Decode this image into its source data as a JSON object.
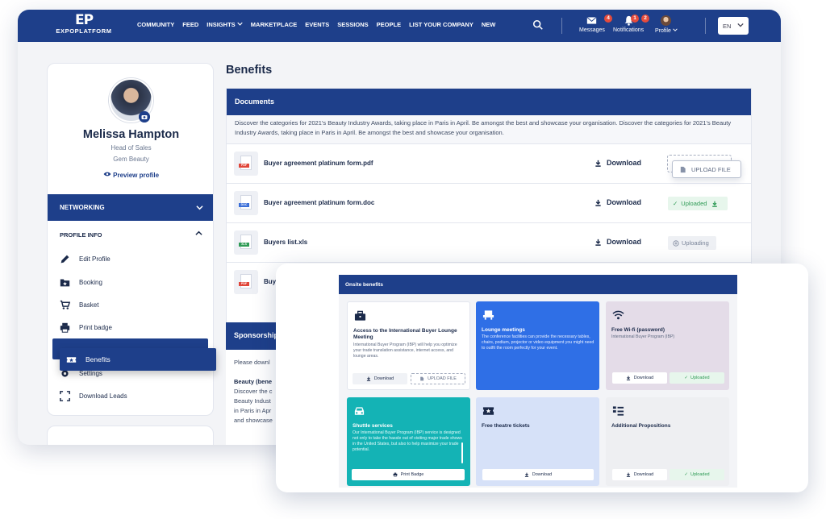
{
  "brand": {
    "mark": "EP",
    "word": "EXPOPLATFORM"
  },
  "nav": [
    "COMMUNITY",
    "FEED",
    "INSIGHTS",
    "MARKETPLACE",
    "EVENTS",
    "SESSIONS",
    "PEOPLE",
    "LIST YOUR COMPANY",
    "NEW"
  ],
  "topbar": {
    "messages_label": "Messages",
    "messages_count": "4",
    "notifications_label": "Notifications",
    "notifications_count_a": "1",
    "notifications_count_b": "2",
    "profile_label": "Profile",
    "language": "EN"
  },
  "profile": {
    "name": "Melissa Hampton",
    "title": "Head of Sales",
    "company": "Gem Beauty",
    "preview": "Preview profile"
  },
  "sidebar": {
    "networking": "NETWORKING",
    "profile_info": "PROFILE INFO",
    "items": [
      "Edit Profile",
      "Booking",
      "Basket",
      "Print badge",
      "Settings",
      "Download Leads"
    ],
    "highlight": "Benefits"
  },
  "main": {
    "title": "Benefits",
    "documents_header": "Documents",
    "documents_desc": "Discover the categories for 2021's Beauty Industry Awards, taking place in Paris in April. Be amongst the best and showcase your organisation. Discover the categories for 2021's Beauty Industry Awards, taking place in Paris in April. Be amongst the best and showcase your organisation.",
    "download_label": "Download",
    "upload_file": "UPLOAD FILE",
    "uploaded": "Uploaded",
    "uploading": "Uploading",
    "files": [
      {
        "name": "Buyer agreement platinum form.pdf",
        "type": "PDF"
      },
      {
        "name": "Buyer agreement platinum form.doc",
        "type": "DOC"
      },
      {
        "name": "Buyers list.xls",
        "type": "XLS"
      },
      {
        "name": "Buy",
        "type": "PDF"
      }
    ],
    "sponsorship_header": "Sponsorship",
    "sponsorship_intro": "Please downl",
    "sponsorship_item_title": "Beauty (bene",
    "sponsorship_item_lines": [
      "Discover the c",
      "Beauty Indust",
      "in Paris in Apr",
      "and showcase"
    ]
  },
  "onsite": {
    "header": "Onsite benefits",
    "cards": [
      {
        "title": "Access to the International Buyer Lounge Meeting",
        "desc": "International Buyer Program (IBP) will help you optimize your trade translation assistance, internet access, and lounge areas.",
        "btn1": "Download",
        "btn2": "UPLOAD FILE"
      },
      {
        "title": "Lounge meetings",
        "desc": "The conference facilities can provide the necessary tables, chairs, podium, projector or video equipment you might need to outfit the room perfectly for your event."
      },
      {
        "title": "Free Wi-fi (password)",
        "desc": "International Buyer Program (IBP)",
        "btn1": "Download",
        "btn2": "Uploaded"
      },
      {
        "title": "Shuttle services",
        "desc": "Our International Buyer Program (IBP) service is designed not only to take the hassle out of visiting major trade shows in the United States, but also to help maximize your trade potential.",
        "btn1": "Print Badge"
      },
      {
        "title": "Free theatre tickets",
        "btn1": "Download"
      },
      {
        "title": "Additional Propositions",
        "btn1": "Download",
        "btn2": "Uploaded"
      }
    ]
  }
}
